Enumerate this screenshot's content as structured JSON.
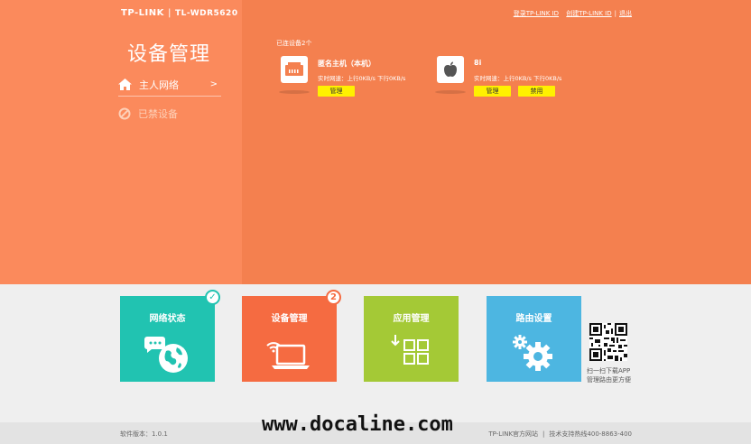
{
  "header": {
    "brand": "TP-LINK",
    "separator": "|",
    "model": "TL-WDR5620",
    "links": [
      "登录TP-LINK ID",
      "创建TP-LINK ID",
      "退出"
    ]
  },
  "sidebar": {
    "title": "设备管理",
    "items": [
      {
        "label": "主人网络",
        "arrow": ">",
        "active": true
      },
      {
        "label": "已禁设备",
        "active": false
      }
    ]
  },
  "main": {
    "connected_label": "已连设备2个",
    "devices": [
      {
        "name": "匿名主机（本机）",
        "speed": "实时网速：上行0KB/s  下行0KB/s",
        "buttons": [
          "管理"
        ]
      },
      {
        "name": "8i",
        "speed": "实时网速：上行0KB/s  下行0KB/s",
        "buttons": [
          "管理",
          "禁用"
        ]
      }
    ]
  },
  "tiles": [
    {
      "label": "网络状态",
      "color": "#21c3b1",
      "icon": "globe-icon",
      "badge": "check"
    },
    {
      "label": "设备管理",
      "color": "#f56b41",
      "icon": "laptop-wifi-icon",
      "badge": "2"
    },
    {
      "label": "应用管理",
      "color": "#a4c936",
      "icon": "apps-grid-icon"
    },
    {
      "label": "路由设置",
      "color": "#4db6e1",
      "icon": "gears-icon"
    }
  ],
  "qr": {
    "line1": "扫一扫下载APP",
    "line2": "管理路由更方便"
  },
  "footer": {
    "version": "软件版本：1.0.1",
    "links": [
      "TP-LINK官方网站",
      "技术支持热线400-8863-400"
    ]
  },
  "watermark": "www.docaline.com"
}
